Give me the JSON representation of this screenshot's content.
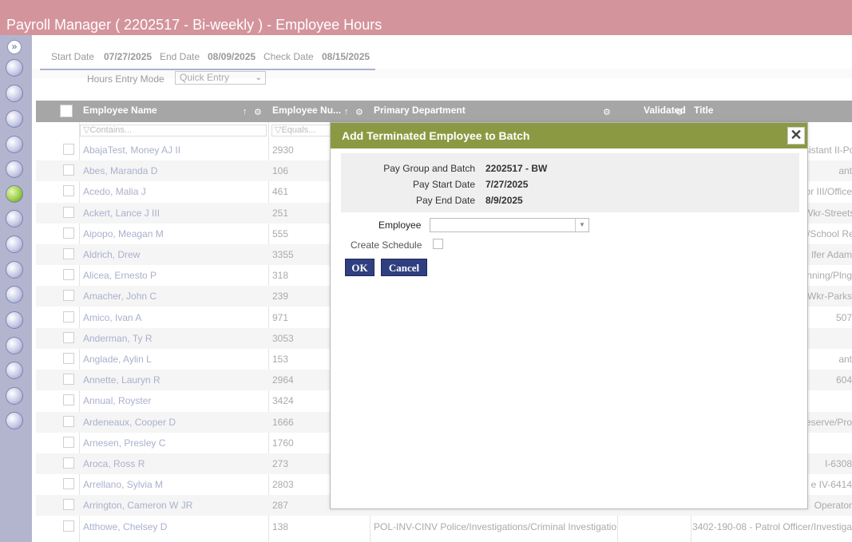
{
  "window": {
    "title": "Payroll Manager ( 2202517 - Bi-weekly ) - Employee Hours"
  },
  "rail": {
    "expand_label": "»",
    "icons": [
      "home-icon",
      "globe-icon",
      "people-icon",
      "chart-icon",
      "money-icon",
      "document-icon",
      "calendar-icon",
      "clipboard-icon",
      "calculator-icon",
      "report-icon",
      "settings-icon",
      "tools-icon",
      "mail-icon",
      "stamp-icon",
      "search-icon"
    ]
  },
  "dates": {
    "start_label": "Start Date",
    "start_value": "07/27/2025",
    "end_label": "End Date",
    "end_value": "08/09/2025",
    "check_label": "Check Date",
    "check_value": "08/15/2025"
  },
  "hours_entry": {
    "label": "Hours Entry Mode",
    "value": "Quick Entry"
  },
  "grid": {
    "columns": [
      "Employee Name",
      "Employee Nu...",
      "Primary Department",
      "Validated",
      "Title"
    ],
    "filters": {
      "name_placeholder": "Contains...",
      "num_placeholder": "Equals..."
    },
    "rows": [
      {
        "name": "AbajaTest, Money AJ II",
        "num": "2930",
        "dept": "",
        "title": "sistant II-Po"
      },
      {
        "name": "Abes, Maranda D",
        "num": "106",
        "dept": "",
        "title": "ant"
      },
      {
        "name": "Acedo, Malia J",
        "num": "461",
        "dept": "",
        "title": "or III/Office"
      },
      {
        "name": "Ackert, Lance J III",
        "num": "251",
        "dept": "",
        "title": "Wkr-Streets"
      },
      {
        "name": "Aipopo, Meagan M",
        "num": "555",
        "dept": "",
        "title": "r/School Re"
      },
      {
        "name": "Aldrich, Drew",
        "num": "3355",
        "dept": "",
        "title": "lfer Adam"
      },
      {
        "name": "Alicea, Ernesto P",
        "num": "318",
        "dept": "",
        "title": "nning/Plng"
      },
      {
        "name": "Amacher, John C",
        "num": "239",
        "dept": "",
        "title": "Wkr-Parks"
      },
      {
        "name": "Amico, Ivan A",
        "num": "971",
        "dept": "",
        "title": "507"
      },
      {
        "name": "Anderman, Ty R",
        "num": "3053",
        "dept": "",
        "title": ""
      },
      {
        "name": "Anglade, Aylin L",
        "num": "153",
        "dept": "",
        "title": "ant"
      },
      {
        "name": "Annette, Lauryn R",
        "num": "2964",
        "dept": "",
        "title": "604"
      },
      {
        "name": "Annual, Royster",
        "num": "3424",
        "dept": "",
        "title": ""
      },
      {
        "name": "Ardeneaux, Cooper D",
        "num": "1666",
        "dept": "",
        "title": "eserve/Pro"
      },
      {
        "name": "Arnesen, Presley C",
        "num": "1760",
        "dept": "",
        "title": ""
      },
      {
        "name": "Aroca, Ross R",
        "num": "273",
        "dept": "",
        "title": "I-6308"
      },
      {
        "name": "Arrellano, Sylvia M",
        "num": "2803",
        "dept": "",
        "title": "e IV-6414"
      },
      {
        "name": "Arrington, Cameron W JR",
        "num": "287",
        "dept": "",
        "title": "Operator"
      },
      {
        "name": "Atthowe, Chelsey D",
        "num": "138",
        "dept": "POL-INV-CINV Police/Investigations/Criminal Investigatio",
        "title": "3402-190-08 - Patrol Officer/Investiga"
      }
    ]
  },
  "dialog": {
    "title": "Add Terminated Employee to Batch",
    "close_label": "✕",
    "pay_group_label": "Pay Group and Batch",
    "pay_group_value": "2202517 - BW",
    "pay_start_label": "Pay Start Date",
    "pay_start_value": "7/27/2025",
    "pay_end_label": "Pay End Date",
    "pay_end_value": "8/9/2025",
    "employee_label": "Employee",
    "employee_value": "",
    "schedule_label": "Create Schedule",
    "ok_label": "OK",
    "cancel_label": "Cancel"
  }
}
